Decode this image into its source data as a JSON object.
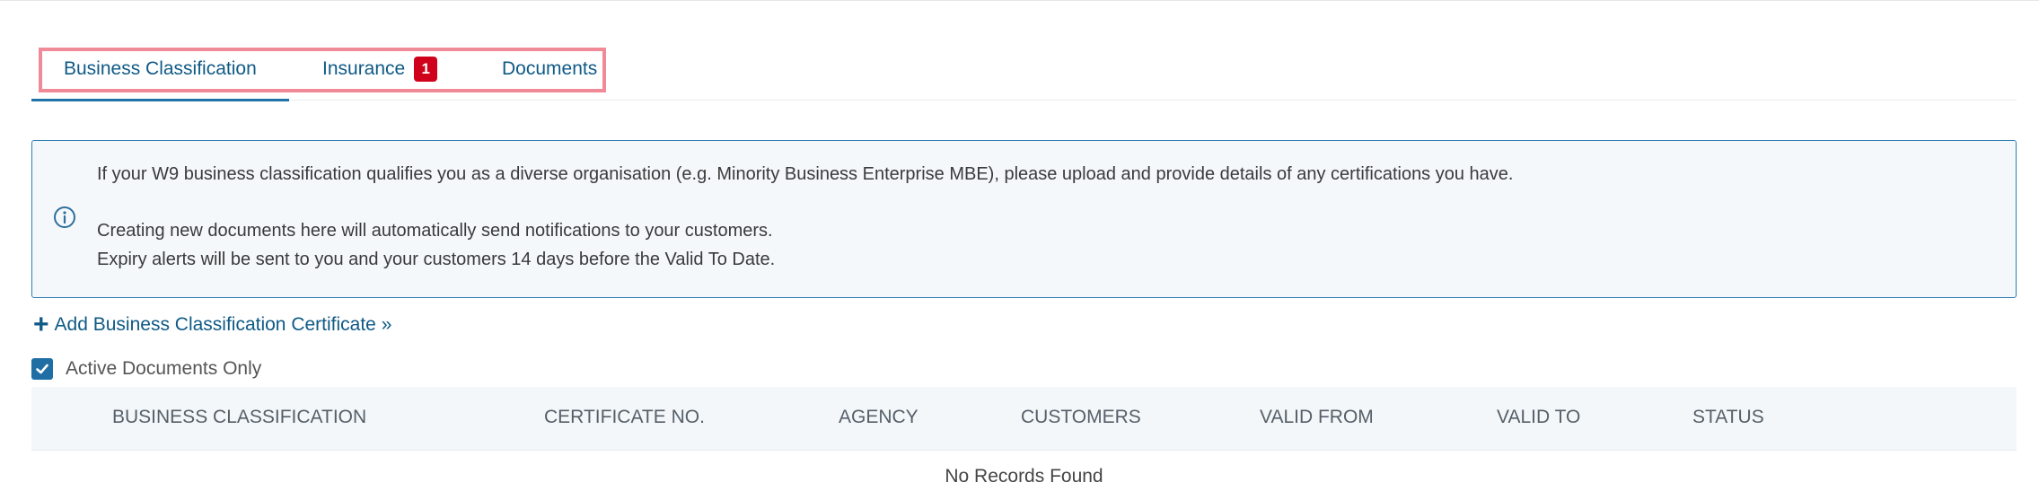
{
  "tabs": {
    "items": [
      {
        "label": "Business Classification"
      },
      {
        "label": "Insurance",
        "badge": "1"
      },
      {
        "label": "Documents"
      }
    ],
    "active_index": 0
  },
  "info": {
    "icon": "info-circle-icon",
    "line1": "If your W9 business classification qualifies you as a diverse organisation (e.g. Minority Business Enterprise MBE), please upload and provide details of any certifications you have.",
    "line2": "Creating new documents here will automatically send notifications to your customers.",
    "line3": "Expiry alerts will be sent to you and your customers 14 days before the Valid To Date."
  },
  "add_link": {
    "icon": "plus-icon",
    "label": "Add Business Classification Certificate »"
  },
  "filter": {
    "label": "Active Documents Only",
    "checked": true
  },
  "table": {
    "columns": [
      {
        "label": "BUSINESS CLASSIFICATION"
      },
      {
        "label": "CERTIFICATE NO."
      },
      {
        "label": "AGENCY"
      },
      {
        "label": "CUSTOMERS"
      },
      {
        "label": "VALID FROM"
      },
      {
        "label": "VALID TO"
      },
      {
        "label": "STATUS"
      }
    ],
    "empty_message": "No Records Found"
  },
  "colors": {
    "accent": "#0f5a86",
    "badge": "#d0021b",
    "highlight": "#f08a96",
    "info_border": "#2f7fb4",
    "info_bg": "#f4f8fb"
  }
}
